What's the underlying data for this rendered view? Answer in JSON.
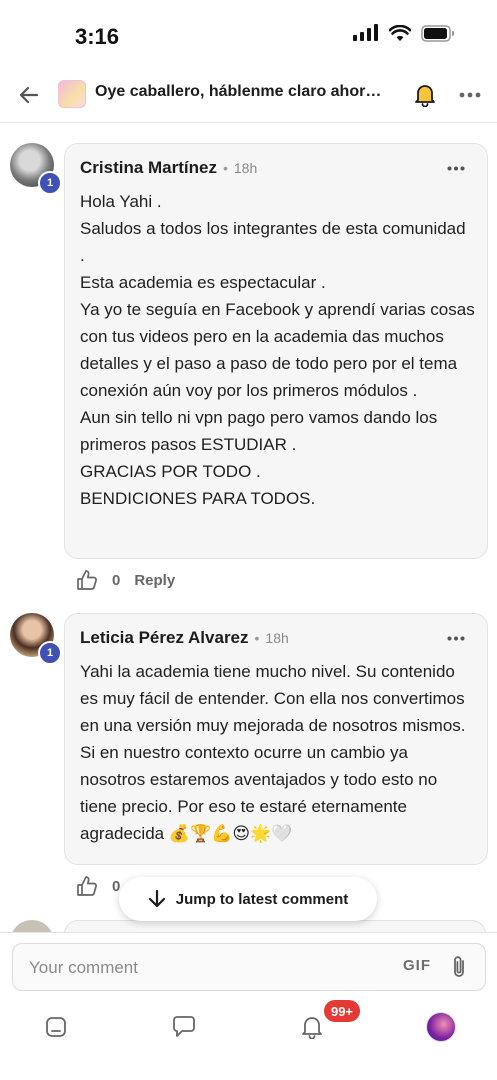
{
  "status_bar": {
    "time": "3:16"
  },
  "header": {
    "title": "Oye caballero, háblenme claro ahora o c...",
    "back_icon": "arrow-left-icon",
    "bell_icon": "bell-icon",
    "more_icon": "more-horizontal-icon"
  },
  "comments": [
    {
      "author": "Cristina Martínez",
      "separator": "•",
      "time": "18h",
      "level": "1",
      "body": [
        "Hola Yahi .",
        "Saludos a todos los integrantes de esta comunidad .",
        "Esta academia es espectacular .",
        "Ya yo te seguía en Facebook y aprendí varias cosas con tus videos pero en la academia das muchos detalles y el paso a paso de todo pero por el tema conexión aún voy por los primeros módulos .",
        "Aun sin tello ni vpn pago pero vamos dando los primeros pasos ESTUDIAR .",
        "GRACIAS POR TODO .",
        "BENDICIONES PARA TODOS."
      ],
      "likes": "0",
      "reply_label": "Reply"
    },
    {
      "author": "Leticia Pérez Alvarez",
      "separator": "•",
      "time": "18h",
      "level": "1",
      "body": [
        "Yahi la academia tiene mucho nivel. Su contenido es muy fácil de entender. Con ella nos convertimos en una versión muy mejorada de nosotros mismos. Si en nuestro contexto ocurre un cambio ya nosotros estaremos aventajados y todo esto no tiene precio. Por eso te estaré eternamente agradecida 💰🏆💪😍🌟🤍"
      ],
      "likes": "0"
    }
  ],
  "jump_button": {
    "label": "Jump to latest comment"
  },
  "composer": {
    "placeholder": "Your comment",
    "gif_label": "GIF"
  },
  "bottom_nav": {
    "notifications_badge": "99+"
  },
  "colors": {
    "level_badge": "#3f51b5",
    "notification_badge": "#e53935",
    "bubble_bg": "#f6f6f6"
  }
}
